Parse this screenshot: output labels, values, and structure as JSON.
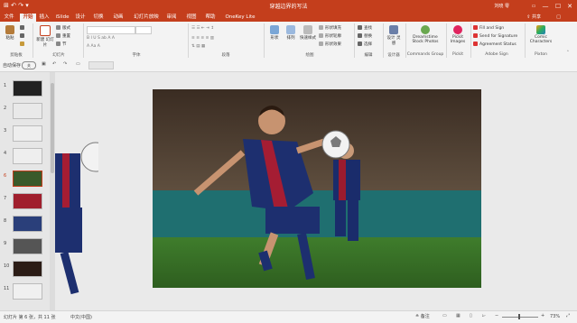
{
  "window": {
    "title": "穿越边界的写法",
    "user": "刘晓 零",
    "minimize": "—",
    "maximize": "☐",
    "close": "✕",
    "qat": "⊞ ↶ ↷ ▾"
  },
  "tabs": [
    {
      "label": "文件",
      "active": false
    },
    {
      "label": "开始",
      "active": true
    },
    {
      "label": "插入",
      "active": false
    },
    {
      "label": "iSlide",
      "active": false
    },
    {
      "label": "设计",
      "active": false
    },
    {
      "label": "切换",
      "active": false
    },
    {
      "label": "动画",
      "active": false
    },
    {
      "label": "幻灯片放映",
      "active": false
    },
    {
      "label": "审阅",
      "active": false
    },
    {
      "label": "视图",
      "active": false
    },
    {
      "label": "帮助",
      "active": false
    },
    {
      "label": "OneKey Lite",
      "active": false
    }
  ],
  "share_label": "共享",
  "comment_label": "□",
  "ribbon": {
    "clipboard": {
      "paste": "粘贴",
      "cut": "剪切",
      "copy": "复制",
      "format": "格式刷",
      "group": "剪贴板"
    },
    "slides": {
      "new": "新建\n幻灯片",
      "layout": "版式",
      "reset": "重置",
      "section": "节",
      "group": "幻灯片"
    },
    "font": {
      "group": "字体"
    },
    "paragraph": {
      "group": "段落"
    },
    "drawing": {
      "shape": "形状",
      "arrange": "排列",
      "quick_styles": "快速样式",
      "fill": "形状填充",
      "outline": "形状轮廓",
      "effect": "形状效果",
      "group": "绘图"
    },
    "editing": {
      "find": "查找",
      "replace": "替换",
      "select": "选择",
      "group": "编辑"
    },
    "designer": {
      "label": "设计\n灵感",
      "group": "设计器"
    },
    "commands": {
      "dreamstime": "Dreamstime Stock Photos",
      "group": "Commands Group"
    },
    "pickit": {
      "label": "Pickit Images",
      "group": "Pickit"
    },
    "adobe": {
      "fill": "Fill and Sign",
      "send": "Send for Signature",
      "status": "Agreement Status",
      "group": "Adobe Sign"
    },
    "picton": {
      "label": "Comic Characters",
      "group": "Pixton"
    }
  },
  "qat_bar": {
    "autosave": "自动保存",
    "toggle": "关"
  },
  "thumbnails": [
    {
      "num": "1",
      "active": false
    },
    {
      "num": "2",
      "active": false
    },
    {
      "num": "3",
      "active": false
    },
    {
      "num": "4",
      "active": false
    },
    {
      "num": "5",
      "active": false
    },
    {
      "num": "6",
      "active": true
    },
    {
      "num": "7",
      "active": false
    },
    {
      "num": "8",
      "active": false
    },
    {
      "num": "9",
      "active": false
    },
    {
      "num": "10",
      "active": false
    },
    {
      "num": "11",
      "active": false
    }
  ],
  "status": {
    "slide": "幻灯片 第 6 张，共 11 张",
    "lang": "中文(中国)",
    "notes": "备注",
    "zoom": "73%"
  }
}
